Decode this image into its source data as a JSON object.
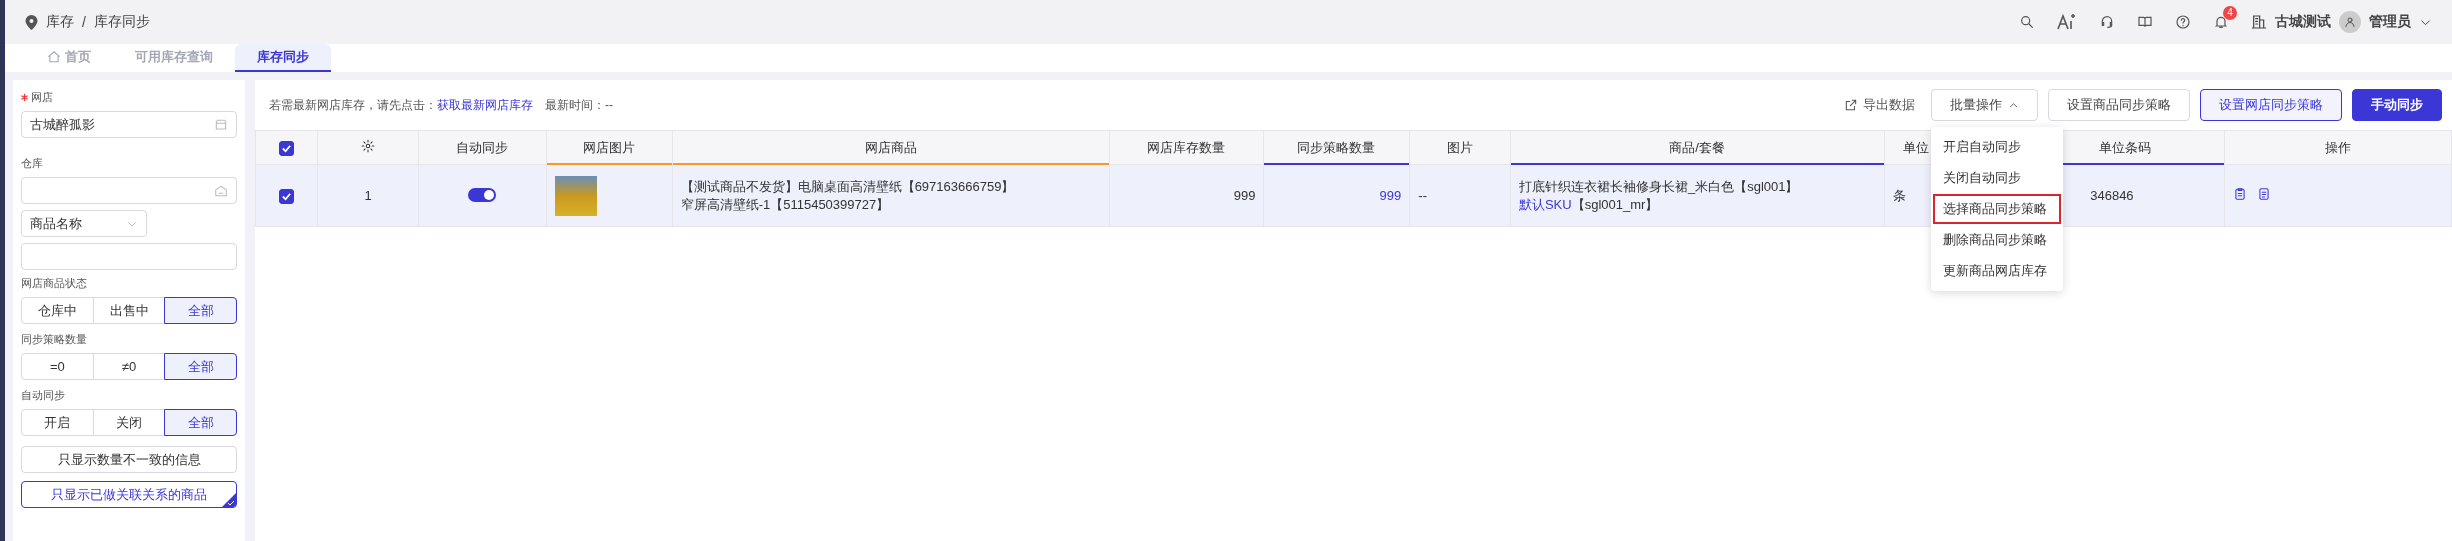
{
  "breadcrumb": {
    "parent": "库存",
    "separator": "/",
    "current": "库存同步"
  },
  "header": {
    "notification_count": "4",
    "organization": "古城测试",
    "user": "管理员"
  },
  "tabs": [
    {
      "label": "首页",
      "kind": "home",
      "selected": false
    },
    {
      "label": "可用库存查询",
      "kind": "plain",
      "selected": false
    },
    {
      "label": "库存同步",
      "kind": "plain",
      "selected": true
    }
  ],
  "sidebar": {
    "shop": {
      "label": "网店",
      "required": true,
      "value": "古城醉孤影"
    },
    "warehouse": {
      "label": "仓库"
    },
    "search_type": {
      "value": "商品名称"
    },
    "groups": [
      {
        "label": "网店商品状态",
        "options": [
          {
            "label": "仓库中",
            "selected": false
          },
          {
            "label": "出售中",
            "selected": false
          },
          {
            "label": "全部",
            "selected": true
          }
        ]
      },
      {
        "label": "同步策略数量",
        "options": [
          {
            "label": "=0",
            "selected": false
          },
          {
            "label": "≠0",
            "selected": false
          },
          {
            "label": "全部",
            "selected": true
          }
        ]
      },
      {
        "label": "自动同步",
        "options": [
          {
            "label": "开启",
            "selected": false
          },
          {
            "label": "关闭",
            "selected": false
          },
          {
            "label": "全部",
            "selected": true
          }
        ]
      }
    ],
    "filters": [
      {
        "label": "只显示数量不一致的信息",
        "selected": false
      },
      {
        "label": "只显示已做关联关系的商品",
        "selected": true
      }
    ]
  },
  "toolbar": {
    "hint": "若需最新网店库存，请先点击：",
    "link": "获取最新网店库存",
    "time": "最新时间：--",
    "export": "导出数据",
    "buttons": [
      {
        "label": "批量操作",
        "kind": "dropdown"
      },
      {
        "label": "设置商品同步策略",
        "kind": "default"
      },
      {
        "label": "设置网店同步策略",
        "kind": "outline"
      },
      {
        "label": "手动同步",
        "kind": "primary"
      }
    ],
    "menu": [
      {
        "label": "开启自动同步",
        "selected": false
      },
      {
        "label": "关闭自动同步",
        "selected": false
      },
      {
        "label": "选择商品同步策略",
        "selected": true
      },
      {
        "label": "删除商品同步策略",
        "selected": false
      },
      {
        "label": "更新商品网店库存",
        "selected": false
      }
    ]
  },
  "table": {
    "all_checked": true,
    "columns": [
      {
        "kind": "checkbox"
      },
      {
        "kind": "gear"
      },
      {
        "kind": "text",
        "label": "自动同步"
      },
      {
        "kind": "shop",
        "label": "网店图片"
      },
      {
        "kind": "shop",
        "label": "网店商品"
      },
      {
        "kind": "text",
        "label": "网店库存数量"
      },
      {
        "kind": "system",
        "label": "同步策略数量"
      },
      {
        "kind": "text",
        "label": "图片"
      },
      {
        "kind": "system",
        "label": "商品/套餐"
      },
      {
        "kind": "text",
        "label": "单位"
      },
      {
        "kind": "system",
        "label": "单位条码"
      },
      {
        "kind": "text",
        "label": "操作"
      }
    ],
    "rows": [
      {
        "selected": true,
        "checked": true,
        "index": "1",
        "auto_sync": true,
        "shop_product": [
          "【测试商品不发货】电脑桌面高清壁纸【697163666759】",
          "窄屏高清壁纸-1【5115450399727】"
        ],
        "stock": "999",
        "strategy_count": "999",
        "image": "--",
        "product": "打底针织连衣裙长袖修身长裙_米白色【sgl001】",
        "sku_link": "默认SKU",
        "sku_code": "【sgl001_mr】",
        "unit": "条",
        "barcode": "346846"
      }
    ]
  }
}
